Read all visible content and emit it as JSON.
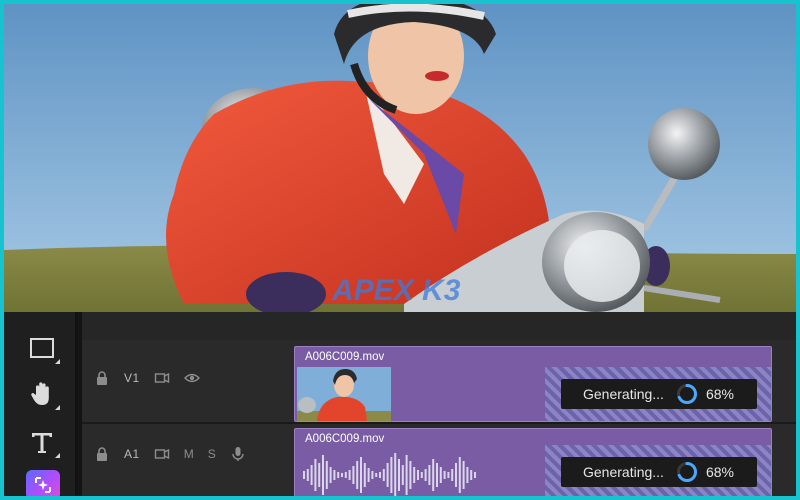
{
  "watermark": {
    "text": "APEX K3"
  },
  "timeline": {
    "tracks": [
      {
        "id": "v1",
        "label": "V1",
        "clip_name": "A006C009.mov",
        "status_text": "Generating...",
        "progress_percent": "68%",
        "progress_value": 0.68
      },
      {
        "id": "a1",
        "label": "A1",
        "clip_name": "A006C009.mov",
        "status_text": "Generating...",
        "progress_percent": "68%",
        "progress_value": 0.68,
        "mute_label": "M",
        "solo_label": "S"
      }
    ]
  },
  "toolbar": {
    "tools": [
      "rectangle-tool-icon",
      "hand-tool-icon",
      "type-tool-icon",
      "generative-ai-icon"
    ]
  },
  "colors": {
    "frame_border": "#17c3cf",
    "clip_purple": "#7a5ca5",
    "progress_ring": "#4aa8ff",
    "ai_gradient_start": "#5b6bff",
    "ai_gradient_end": "#e04bd2"
  }
}
